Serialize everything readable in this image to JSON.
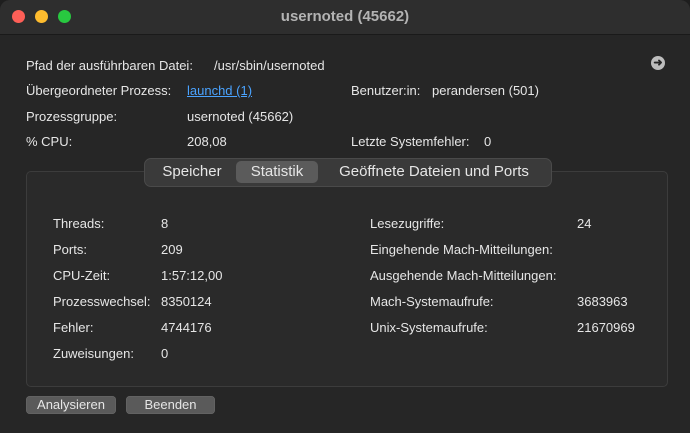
{
  "window": {
    "title": "usernoted (45662)"
  },
  "info": {
    "path_label": "Pfad der ausführbaren Datei:",
    "path_value": "/usr/sbin/usernoted",
    "parent_label": "Übergeordneter Prozess:",
    "parent_value": "launchd (1)",
    "user_label": "Benutzer:in:",
    "user_value": "perandersen (501)",
    "group_label": "Prozessgruppe:",
    "group_value": "usernoted (45662)",
    "cpu_label": "% CPU:",
    "cpu_value": "208,08",
    "errors_label": "Letzte Systemfehler:",
    "errors_value": "0"
  },
  "tabs": [
    {
      "label": "Speicher"
    },
    {
      "label": "Statistik"
    },
    {
      "label": "Geöffnete Dateien und Ports"
    }
  ],
  "active_tab": "Statistik",
  "stats_left": [
    {
      "label": "Threads:",
      "value": "8"
    },
    {
      "label": "Ports:",
      "value": "209"
    },
    {
      "label": "CPU-Zeit:",
      "value": "1:57:12,00"
    },
    {
      "label": "Prozesswechsel:",
      "value": "8350124"
    },
    {
      "label": "Fehler:",
      "value": "4744176"
    },
    {
      "label": "Zuweisungen:",
      "value": "0"
    }
  ],
  "stats_right": [
    {
      "label": "Lesezugriffe:",
      "value": "24"
    },
    {
      "label": "Eingehende Mach-Mitteilungen:",
      "value": ""
    },
    {
      "label": "Ausgehende Mach-Mitteilungen:",
      "value": ""
    },
    {
      "label": "Mach-Systemaufrufe:",
      "value": "3683963"
    },
    {
      "label": "Unix-Systemaufrufe:",
      "value": "21670969"
    }
  ],
  "buttons": {
    "analyze": "Analysieren",
    "quit": "Beenden"
  },
  "icons": {
    "reveal": "arrow-right-circle-icon"
  }
}
